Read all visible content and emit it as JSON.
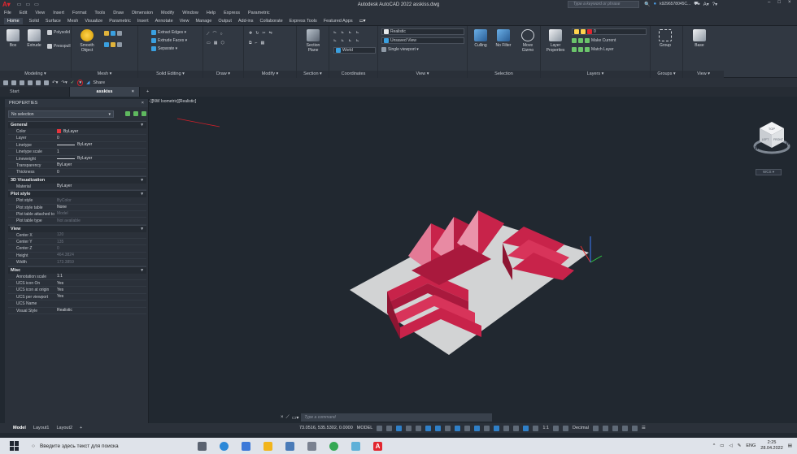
{
  "titlebar": {
    "app_title": "Autodesk AutoCAD 2022   asskiss.dwg",
    "search_placeholder": "Type a keyword or phrase",
    "user": "k9296578045C...",
    "window_controls": [
      "–",
      "□",
      "×"
    ]
  },
  "menubar": {
    "items": [
      "File",
      "Edit",
      "View",
      "Insert",
      "Format",
      "Tools",
      "Draw",
      "Dimension",
      "Modify",
      "Window",
      "Help",
      "Express",
      "Parametric"
    ]
  },
  "ribbon_tabs": {
    "items": [
      "Home",
      "Solid",
      "Surface",
      "Mesh",
      "Visualize",
      "Parametric",
      "Insert",
      "Annotate",
      "View",
      "Manage",
      "Output",
      "Add-ins",
      "Collaborate",
      "Express Tools",
      "Featured Apps"
    ],
    "active": "Home"
  },
  "ribbon": {
    "modeling": {
      "box": "Box",
      "extrude": "Extrude",
      "polysolid": "Polysolid",
      "presspull": "Presspull",
      "label": "Modeling ▾"
    },
    "mesh": {
      "smooth": "Smooth Object",
      "label": "Mesh ▾"
    },
    "solid_editing": {
      "extract": "Extract Edges ▾",
      "extrude_faces": "Extrude Faces ▾",
      "separate": "Separate ▾",
      "label": "Solid Editing ▾"
    },
    "draw": {
      "label": "Draw ▾"
    },
    "modify": {
      "label": "Modify ▾"
    },
    "section": {
      "plane": "Section Plane",
      "label": "Section ▾"
    },
    "coordinates": {
      "world": "World",
      "label": "Coordinates"
    },
    "view": {
      "visual_style": "Realistic",
      "saved_view": "Unsaved View",
      "viewport": "Single viewport ▾",
      "label": "View ▾"
    },
    "selection": {
      "culling": "Culling",
      "no_filter": "No Filter",
      "move_gizmo": "Move Gizmo",
      "label": "Selection"
    },
    "layers": {
      "properties": "Layer Properties",
      "layer_value": "0",
      "make_current": "Make Current",
      "match_layer": "Match Layer",
      "label": "Layers ▾"
    },
    "groups": {
      "group": "Group",
      "label": "Groups ▾"
    },
    "view2": {
      "base": "Base",
      "label": "View ▾"
    }
  },
  "qat": {
    "share": "Share"
  },
  "doc_tabs": {
    "start": "Start",
    "active": "asskiss",
    "close": "×",
    "add": "+"
  },
  "viewport": {
    "label": "[−][NW Isometric][Realistic]",
    "viewcube": {
      "top": "TOP",
      "left": "LEFT",
      "front": "FRONT",
      "north": "N",
      "west": "W"
    },
    "wcs": "WCS ▾"
  },
  "properties": {
    "title": "PROPERTIES",
    "selection": "No selection",
    "sections": [
      {
        "name": "General",
        "rows": [
          {
            "k": "Color",
            "v": "ByLayer",
            "swatch": "#e6343c"
          },
          {
            "k": "Layer",
            "v": "0"
          },
          {
            "k": "Linetype",
            "v": "ByLayer",
            "line": true
          },
          {
            "k": "Linetype scale",
            "v": "1"
          },
          {
            "k": "Lineweight",
            "v": "ByLayer",
            "line": true
          },
          {
            "k": "Transparency",
            "v": "ByLayer"
          },
          {
            "k": "Thickness",
            "v": "0"
          }
        ]
      },
      {
        "name": "3D Visualization",
        "rows": [
          {
            "k": "Material",
            "v": "ByLayer"
          }
        ]
      },
      {
        "name": "Plot style",
        "rows": [
          {
            "k": "Plot style",
            "v": "ByColor",
            "dim": true
          },
          {
            "k": "Plot style table",
            "v": "None"
          },
          {
            "k": "Plot table attached to",
            "v": "Model",
            "dim": true
          },
          {
            "k": "Plot table type",
            "v": "Not available",
            "dim": true
          }
        ]
      },
      {
        "name": "View",
        "rows": [
          {
            "k": "Center X",
            "v": "120",
            "dim": true
          },
          {
            "k": "Center Y",
            "v": "135",
            "dim": true
          },
          {
            "k": "Center Z",
            "v": "0",
            "dim": true
          },
          {
            "k": "Height",
            "v": "464.3824",
            "dim": true
          },
          {
            "k": "Width",
            "v": "173.3859",
            "dim": true
          }
        ]
      },
      {
        "name": "Misc",
        "rows": [
          {
            "k": "Annotation scale",
            "v": "1:1"
          },
          {
            "k": "UCS icon On",
            "v": "Yes"
          },
          {
            "k": "UCS icon at origin",
            "v": "Yes"
          },
          {
            "k": "UCS per viewport",
            "v": "Yes"
          },
          {
            "k": "UCS Name",
            "v": ""
          },
          {
            "k": "Visual Style",
            "v": "Realistic"
          }
        ]
      }
    ]
  },
  "layout_tabs": {
    "items": [
      "Model",
      "Layout1",
      "Layout2",
      "+"
    ]
  },
  "command": {
    "placeholder": "Type a command"
  },
  "status": {
    "coords": "73.0516, 535.5302, 0.0000",
    "space": "MODEL",
    "scale": "1:1",
    "units": "Decimal"
  },
  "taskbar": {
    "search": "Введите здесь текст для поиска",
    "lang": "ENG",
    "time": "2:25",
    "date": "28.04.2022"
  },
  "colors": {
    "accent": "#e2262f",
    "solid": "#c8234a",
    "base_plate": "#d2d3d4",
    "ucs_x": "#e03030",
    "ucs_y": "#2ecc40",
    "ucs_z": "#3a7bff"
  }
}
